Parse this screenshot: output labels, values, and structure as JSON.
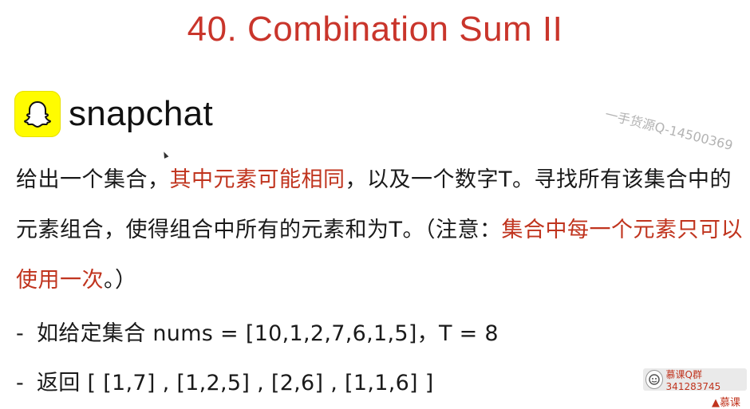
{
  "slide": {
    "title": "40. Combination Sum II",
    "brand": "snapchat",
    "paragraph": {
      "p1": "给出一个集合，",
      "p2": "其中元素可能相同",
      "p3": "，以及一个数字T。寻找所有该集合中的元素组合，使得组合中所有的元素和为T。（注意：",
      "p4": "集合中每一个元素只可以使用一次",
      "p5": "。）"
    },
    "items": [
      {
        "dash": "-",
        "text": "如给定集合 nums = [10,1,2,7,6,1,5]，T = 8"
      },
      {
        "dash": "-",
        "text": "返回 [ [1,7] , [1,2,5] , [2,6] , [1,1,6] ]"
      }
    ]
  },
  "overlay": {
    "watermark": "一手货源Q-14500369",
    "badge": "慕课Q群341283745",
    "corner": "▲慕课"
  },
  "colors": {
    "title": "#c9352b",
    "highlight": "#c0341e",
    "snapchat_yellow": "#fffc00"
  },
  "icons": {
    "brand_logo": "snapchat-ghost-icon",
    "badge_logo": "mooc-icon"
  }
}
